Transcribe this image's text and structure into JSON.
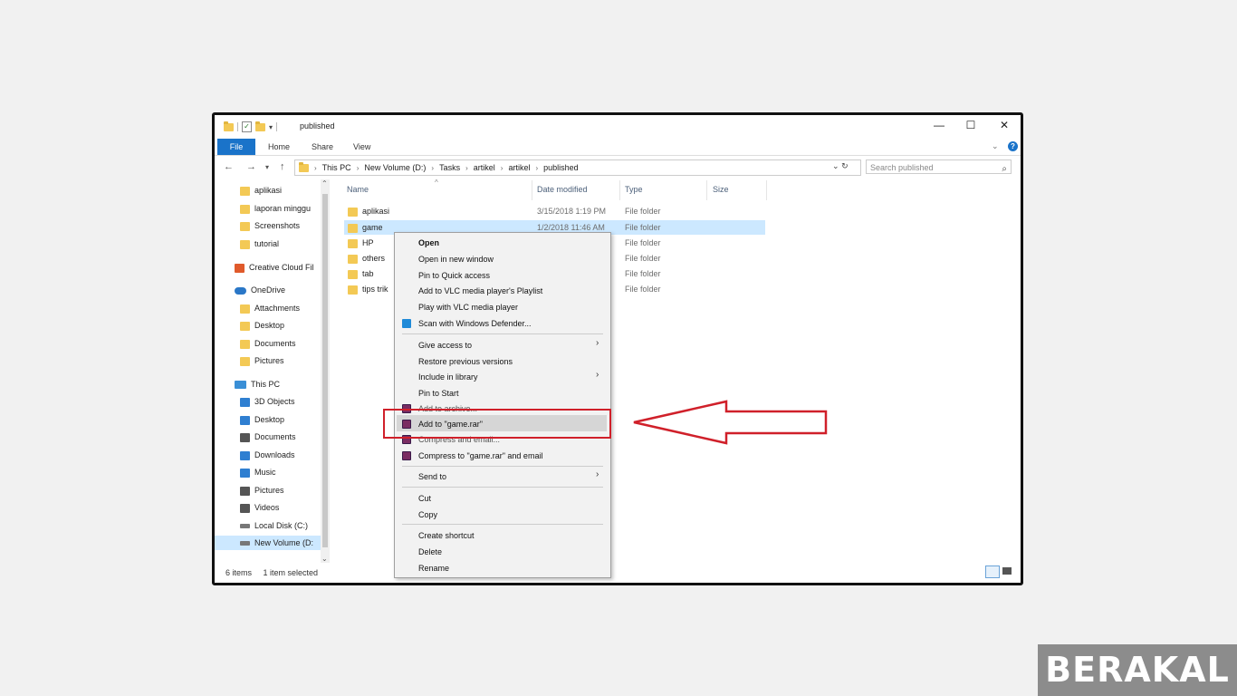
{
  "window": {
    "title": "published",
    "controls": {
      "minimize": "—",
      "maximize": "☐",
      "close": "✕"
    }
  },
  "ribbon": {
    "tabs": [
      "File",
      "Home",
      "Share",
      "View"
    ]
  },
  "address": {
    "breadcrumb": [
      "This PC",
      "New Volume (D:)",
      "Tasks",
      "artikel",
      "artikel",
      "published"
    ],
    "search_placeholder": "Search published"
  },
  "nav_pane": {
    "items": [
      {
        "label": "aplikasi",
        "icon": "folder-icon"
      },
      {
        "label": "laporan minggu",
        "icon": "folder-icon"
      },
      {
        "label": "Screenshots",
        "icon": "folder-icon"
      },
      {
        "label": "tutorial",
        "icon": "folder-icon"
      },
      {
        "label": "Creative Cloud Fil",
        "icon": "creative-cloud-icon"
      },
      {
        "label": "OneDrive",
        "icon": "cloud-icon"
      },
      {
        "label": "Attachments",
        "icon": "folder-icon"
      },
      {
        "label": "Desktop",
        "icon": "folder-icon"
      },
      {
        "label": "Documents",
        "icon": "folder-icon"
      },
      {
        "label": "Pictures",
        "icon": "folder-icon"
      },
      {
        "label": "This PC",
        "icon": "computer-icon"
      },
      {
        "label": "3D Objects",
        "icon": "cube-icon"
      },
      {
        "label": "Desktop",
        "icon": "desktop-icon"
      },
      {
        "label": "Documents",
        "icon": "document-icon"
      },
      {
        "label": "Downloads",
        "icon": "download-icon"
      },
      {
        "label": "Music",
        "icon": "music-icon"
      },
      {
        "label": "Pictures",
        "icon": "picture-icon"
      },
      {
        "label": "Videos",
        "icon": "video-icon"
      },
      {
        "label": "Local Disk (C:)",
        "icon": "drive-icon"
      },
      {
        "label": "New Volume (D:",
        "icon": "drive-icon"
      }
    ]
  },
  "file_list": {
    "columns": {
      "name": "Name",
      "date": "Date modified",
      "type": "Type",
      "size": "Size"
    },
    "rows": [
      {
        "name": "aplikasi",
        "date": "3/15/2018 1:19 PM",
        "type": "File folder"
      },
      {
        "name": "game",
        "date": "1/2/2018 11:46 AM",
        "type": "File folder"
      },
      {
        "name": "HP",
        "date": "",
        "type": "File folder"
      },
      {
        "name": "others",
        "date": "",
        "type": "File folder"
      },
      {
        "name": "tab",
        "date": "",
        "type": "File folder"
      },
      {
        "name": "tips trik",
        "date": "",
        "type": "File folder"
      }
    ]
  },
  "status": {
    "count": "6 items",
    "selection": "1 item selected"
  },
  "context_menu": {
    "items": [
      "Open",
      "Open in new window",
      "Pin to Quick access",
      "Add to VLC media player's Playlist",
      "Play with VLC media player",
      "Scan with Windows Defender...",
      "Give access to",
      "Restore previous versions",
      "Include in library",
      "Pin to Start",
      "Add to archive...",
      "Add to \"game.rar\"",
      "Compress and email...",
      "Compress to \"game.rar\" and email",
      "Send to",
      "Cut",
      "Copy",
      "Create shortcut",
      "Delete",
      "Rename"
    ]
  },
  "annotation_color": "#d0202a",
  "watermark": "BERAKAL"
}
